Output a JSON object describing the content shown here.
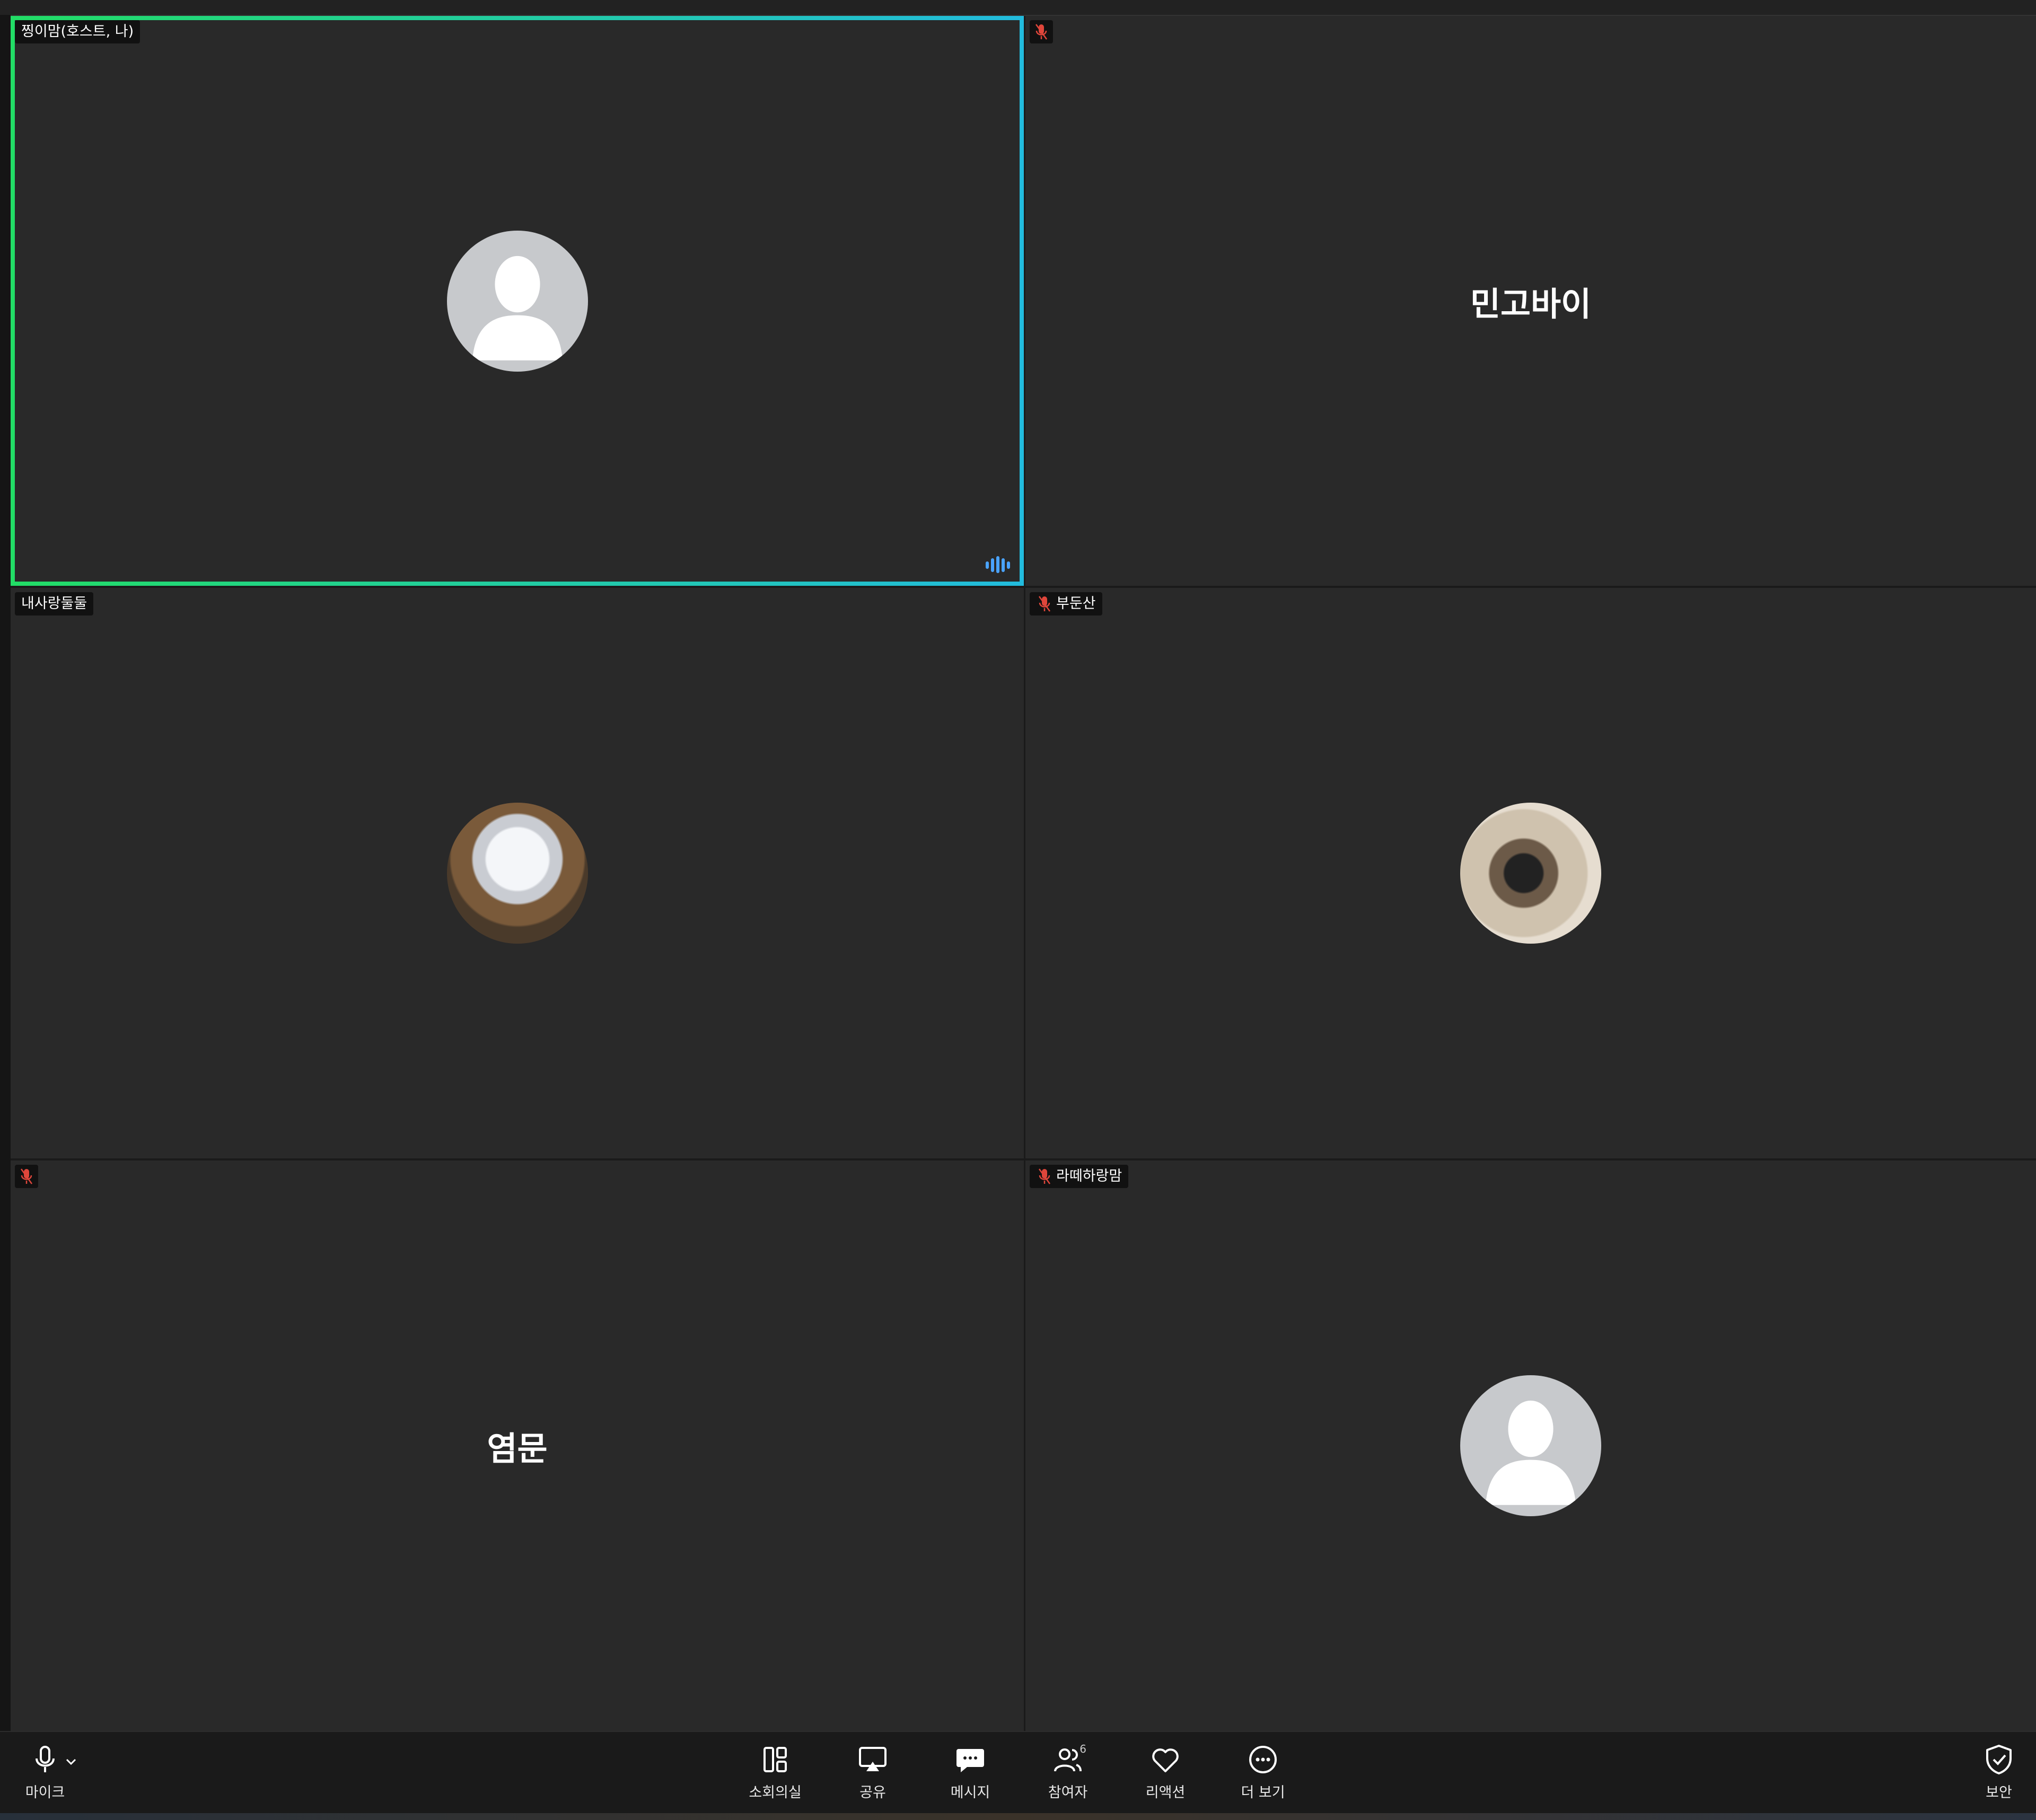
{
  "tiles": [
    {
      "name_tag": "찡이맘(호스트, 나)"
    },
    {
      "display_name": "민고바이"
    },
    {
      "name_tag": "내사랑둘둘"
    },
    {
      "name_tag": "부둔산"
    },
    {
      "display_name": "염문"
    },
    {
      "name_tag": "라떼하랑맘"
    }
  ],
  "toolbar": {
    "mic_label": "마이크",
    "breakout_label": "소회의실",
    "share_label": "공유",
    "chat_label": "메시지",
    "participants_label": "참여자",
    "participants_count": "6",
    "reactions_label": "리액션",
    "more_label": "더 보기",
    "security_label": "보안"
  },
  "colors": {
    "tile_bg": "#292929",
    "speaker_border_start": "#22dd66",
    "speaker_border_end": "#22bbdd",
    "mute_red": "#e0463b",
    "audio_blue": "#4aa3ff"
  },
  "icons": [
    "microphone-icon",
    "chevron-up-icon",
    "breakout-rooms-icon",
    "share-screen-icon",
    "chat-icon",
    "participants-icon",
    "heart-icon",
    "more-icon",
    "shield-check-icon",
    "mic-muted-icon",
    "audio-level-icon",
    "default-avatar-icon"
  ]
}
